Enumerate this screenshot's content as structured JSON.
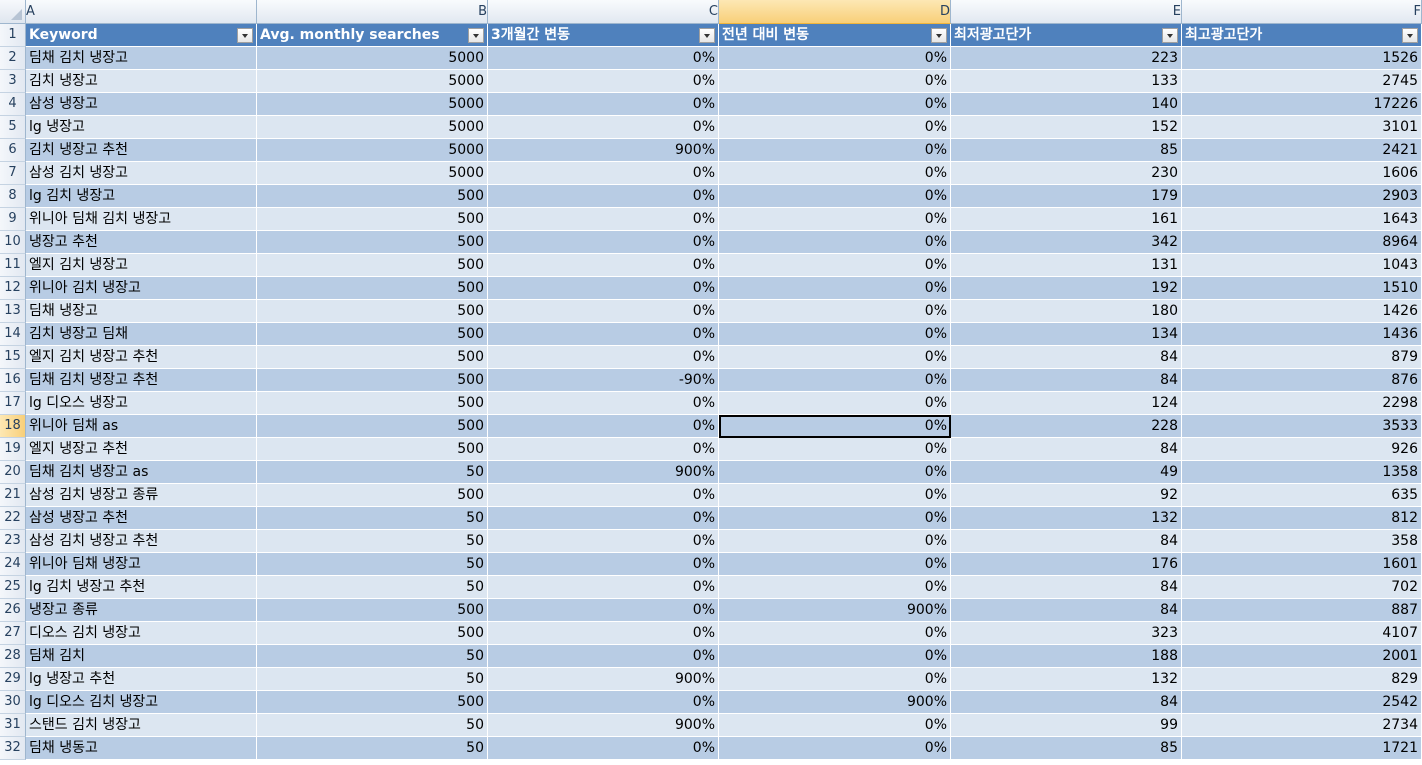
{
  "sheet": {
    "column_letters": [
      "A",
      "B",
      "C",
      "D",
      "E",
      "F"
    ],
    "active_column": "D",
    "selected_cell": {
      "row": 18,
      "col": "D"
    },
    "header_row": {
      "row_number": 1,
      "cells": [
        "Keyword",
        "Avg. monthly searches",
        "3개월간 변동",
        "전년 대비 변동",
        "최저광고단가",
        "최고광고단가"
      ]
    },
    "rows": [
      {
        "n": 2,
        "cells": [
          "딤채 김치 냉장고",
          "5000",
          "0%",
          "0%",
          "223",
          "1526"
        ]
      },
      {
        "n": 3,
        "cells": [
          "김치 냉장고",
          "5000",
          "0%",
          "0%",
          "133",
          "2745"
        ]
      },
      {
        "n": 4,
        "cells": [
          "삼성 냉장고",
          "5000",
          "0%",
          "0%",
          "140",
          "17226"
        ]
      },
      {
        "n": 5,
        "cells": [
          "lg 냉장고",
          "5000",
          "0%",
          "0%",
          "152",
          "3101"
        ]
      },
      {
        "n": 6,
        "cells": [
          "김치 냉장고 추천",
          "5000",
          "900%",
          "0%",
          "85",
          "2421"
        ]
      },
      {
        "n": 7,
        "cells": [
          "삼성 김치 냉장고",
          "5000",
          "0%",
          "0%",
          "230",
          "1606"
        ]
      },
      {
        "n": 8,
        "cells": [
          "lg 김치 냉장고",
          "500",
          "0%",
          "0%",
          "179",
          "2903"
        ]
      },
      {
        "n": 9,
        "cells": [
          "위니아 딤채 김치 냉장고",
          "500",
          "0%",
          "0%",
          "161",
          "1643"
        ]
      },
      {
        "n": 10,
        "cells": [
          "냉장고 추천",
          "500",
          "0%",
          "0%",
          "342",
          "8964"
        ]
      },
      {
        "n": 11,
        "cells": [
          "엘지 김치 냉장고",
          "500",
          "0%",
          "0%",
          "131",
          "1043"
        ]
      },
      {
        "n": 12,
        "cells": [
          "위니아 김치 냉장고",
          "500",
          "0%",
          "0%",
          "192",
          "1510"
        ]
      },
      {
        "n": 13,
        "cells": [
          "딤채 냉장고",
          "500",
          "0%",
          "0%",
          "180",
          "1426"
        ]
      },
      {
        "n": 14,
        "cells": [
          "김치 냉장고 딤채",
          "500",
          "0%",
          "0%",
          "134",
          "1436"
        ]
      },
      {
        "n": 15,
        "cells": [
          "엘지 김치 냉장고 추천",
          "500",
          "0%",
          "0%",
          "84",
          "879"
        ]
      },
      {
        "n": 16,
        "cells": [
          "딤채 김치 냉장고 추천",
          "500",
          "-90%",
          "0%",
          "84",
          "876"
        ]
      },
      {
        "n": 17,
        "cells": [
          "lg 디오스 냉장고",
          "500",
          "0%",
          "0%",
          "124",
          "2298"
        ]
      },
      {
        "n": 18,
        "cells": [
          "위니아 딤채 as",
          "500",
          "0%",
          "0%",
          "228",
          "3533"
        ]
      },
      {
        "n": 19,
        "cells": [
          "엘지 냉장고 추천",
          "500",
          "0%",
          "0%",
          "84",
          "926"
        ]
      },
      {
        "n": 20,
        "cells": [
          "딤채 김치 냉장고 as",
          "50",
          "900%",
          "0%",
          "49",
          "1358"
        ]
      },
      {
        "n": 21,
        "cells": [
          "삼성 김치 냉장고 종류",
          "500",
          "0%",
          "0%",
          "92",
          "635"
        ]
      },
      {
        "n": 22,
        "cells": [
          "삼성 냉장고 추천",
          "50",
          "0%",
          "0%",
          "132",
          "812"
        ]
      },
      {
        "n": 23,
        "cells": [
          "삼성 김치 냉장고 추천",
          "50",
          "0%",
          "0%",
          "84",
          "358"
        ]
      },
      {
        "n": 24,
        "cells": [
          "위니아 딤채 냉장고",
          "50",
          "0%",
          "0%",
          "176",
          "1601"
        ]
      },
      {
        "n": 25,
        "cells": [
          "lg 김치 냉장고 추천",
          "50",
          "0%",
          "0%",
          "84",
          "702"
        ]
      },
      {
        "n": 26,
        "cells": [
          "냉장고 종류",
          "500",
          "0%",
          "900%",
          "84",
          "887"
        ]
      },
      {
        "n": 27,
        "cells": [
          "디오스 김치 냉장고",
          "500",
          "0%",
          "0%",
          "323",
          "4107"
        ]
      },
      {
        "n": 28,
        "cells": [
          "딤채 김치",
          "50",
          "0%",
          "0%",
          "188",
          "2001"
        ]
      },
      {
        "n": 29,
        "cells": [
          "lg 냉장고 추천",
          "50",
          "900%",
          "0%",
          "132",
          "829"
        ]
      },
      {
        "n": 30,
        "cells": [
          "lg 디오스 김치 냉장고",
          "500",
          "0%",
          "900%",
          "84",
          "2542"
        ]
      },
      {
        "n": 31,
        "cells": [
          "스탠드 김치 냉장고",
          "50",
          "900%",
          "0%",
          "99",
          "2734"
        ]
      },
      {
        "n": 32,
        "cells": [
          "딤채 냉동고",
          "50",
          "0%",
          "0%",
          "85",
          "1721"
        ]
      }
    ]
  },
  "colors": {
    "table_header": "#4f81bd",
    "band_dark": "#b8cce4",
    "band_light": "#dce6f1",
    "active_header": "#f8cf79"
  },
  "icons": {
    "filter_dropdown": "dropdown-arrow-icon",
    "select_all_corner": "select-all-triangle-icon"
  }
}
